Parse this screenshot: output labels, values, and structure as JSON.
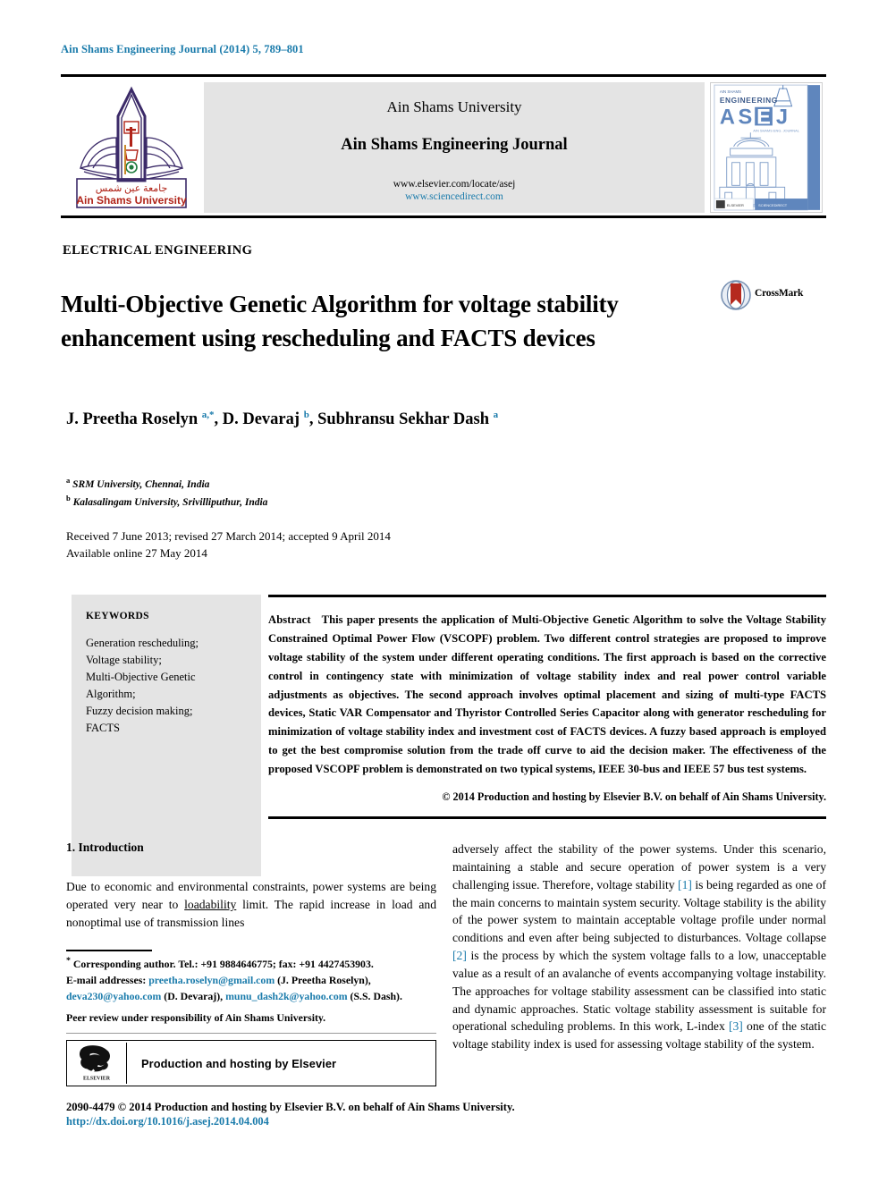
{
  "running_head": "Ain Shams Engineering Journal (2014) 5, 789–801",
  "masthead": {
    "university": "Ain Shams University",
    "journal": "Ain Shams Engineering Journal",
    "url_elsevier": "www.elsevier.com/locate/asej",
    "url_sciencedirect": "www.sciencedirect.com",
    "logo_caption_ar": "جامعة عين شمس",
    "logo_caption_en": "Ain Shams University",
    "cover": {
      "top_small": "ASEJ",
      "eyebrow": "ENGINEERING",
      "wordmark": "ASEJ",
      "subline": "AIN SHAMS ENGINEERING JOURNAL"
    }
  },
  "article": {
    "section_label": "ELECTRICAL ENGINEERING",
    "title": "Multi-Objective Genetic Algorithm for voltage stability enhancement using rescheduling and FACTS devices",
    "crossmark_label": "CrossMark",
    "authors_html": "J. Preetha Roselyn <sup>a,*</sup>, D. Devaraj <sup>b</sup>, Subhransu Sekhar Dash <sup>a</sup>",
    "affiliations": [
      {
        "marker": "a",
        "text": "SRM University, Chennai, India"
      },
      {
        "marker": "b",
        "text": "Kalasalingam University, Srivilliputhur, India"
      }
    ],
    "history_line1": "Received 7 June 2013; revised 27 March 2014; accepted 9 April 2014",
    "history_line2": "Available online 27 May 2014"
  },
  "keywords": {
    "title": "KEYWORDS",
    "items": [
      "Generation rescheduling;",
      "Voltage stability;",
      "Multi-Objective Genetic",
      "Algorithm;",
      "Fuzzy decision making;",
      "FACTS"
    ]
  },
  "abstract": {
    "heading": "Abstract",
    "text": "This paper presents the application of Multi-Objective Genetic Algorithm to solve the Voltage Stability Constrained Optimal Power Flow (VSCOPF) problem. Two different control strategies are proposed to improve voltage stability of the system under different operating conditions. The first approach is based on the corrective control in contingency state with minimization of voltage stability index and real power control variable adjustments as objectives. The second approach involves optimal placement and sizing of multi-type FACTS devices, Static VAR Compensator and Thyristor Controlled Series Capacitor along with generator rescheduling for minimization of voltage stability index and investment cost of FACTS devices. A fuzzy based approach is employed to get the best compromise solution from the trade off curve to aid the decision maker. The effectiveness of the proposed VSCOPF problem is demonstrated on two typical systems, IEEE 30-bus and IEEE 57 bus test systems.",
    "copyright": "© 2014 Production and hosting by Elsevier B.V. on behalf of Ain Shams University."
  },
  "body": {
    "section_heading": "1. Introduction",
    "left_paragraph_html": "Due to economic and environmental constraints, power systems are being operated very near to <span class=\"u\">loadability</span> limit. The rapid increase in load and nonoptimal use of transmission lines",
    "right_paragraph_html": "adversely affect the stability of the power systems. Under this scenario, maintaining a stable and secure operation of power system is a very challenging issue. Therefore, voltage stability <span class=\"ref\">[1]</span> is being regarded as one of the main concerns to maintain system security. Voltage stability is the ability of the power system to maintain acceptable voltage profile under normal conditions and even after being subjected to disturbances. Voltage collapse <span class=\"ref\">[2]</span> is the process by which the system voltage falls to a low, unacceptable value as a result of an avalanche of events accompanying voltage instability. The approaches for voltage stability assessment can be classified into static and dynamic approaches. Static voltage stability assessment is suitable for operational scheduling problems. In this work, L-index <span class=\"ref\">[3]</span> one of the static voltage stability index is used for assessing voltage stability of the system."
  },
  "footnote": {
    "corresponding_html": "<sup>*</sup> Corresponding author. Tel.: +91 9884646775; fax: +91 4427453903.",
    "emails_html": "E-mail addresses: <span class=\"mail\">preetha.roselyn@gmail.com</span> (J. Preetha Roselyn), <span class=\"mail\">deva230@yahoo.com</span> (D. Devaraj), <span class=\"mail\">munu_dash2k@yahoo.com</span> (S.S. Dash).",
    "peer_review": "Peer review under responsibility of Ain Shams University."
  },
  "elsevier_box": {
    "logo_word": "ELSEVIER",
    "text": "Production and hosting by Elsevier"
  },
  "footer": {
    "issn_line": "2090-4479 © 2014 Production and hosting by Elsevier B.V. on behalf of Ain Shams University.",
    "doi": "http://dx.doi.org/10.1016/j.asej.2014.04.004"
  },
  "colors": {
    "link": "#1a7bab",
    "masthead_bg": "#e4e4e4",
    "logo_purple": "#3b2a68",
    "logo_red": "#b02318",
    "cover_blue": "#5f86bd",
    "crossmark_red": "#b5291f",
    "crossmark_blue": "#4a6fa5"
  }
}
